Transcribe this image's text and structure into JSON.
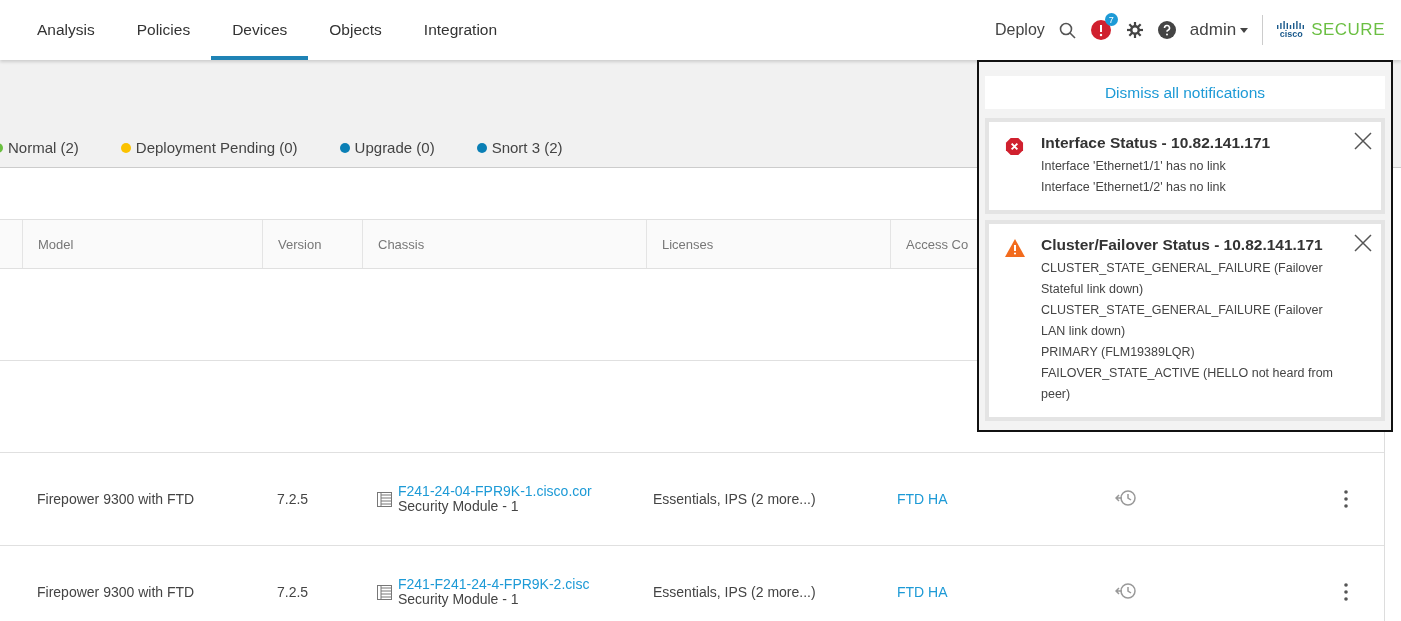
{
  "nav": {
    "tabs": [
      {
        "label": "Analysis",
        "selected": false
      },
      {
        "label": "Policies",
        "selected": false
      },
      {
        "label": "Devices",
        "selected": true
      },
      {
        "label": "Objects",
        "selected": false
      },
      {
        "label": "Integration",
        "selected": false
      }
    ],
    "deploy": "Deploy",
    "notification_count": "7",
    "user": "admin",
    "logo": {
      "wordmark": "cisco",
      "product": "SECURE"
    }
  },
  "status_legend": [
    {
      "label": "Normal (2)",
      "color": "#6abf3f"
    },
    {
      "label": "Deployment Pending (0)",
      "color": "#fbc200"
    },
    {
      "label": "Upgrade (0)",
      "color": "#0a7fb5"
    },
    {
      "label": "Snort 3 (2)",
      "color": "#0a7fb5"
    }
  ],
  "table": {
    "columns": [
      "Model",
      "Version",
      "Chassis",
      "Licenses",
      "Access Co"
    ],
    "rows": [
      {
        "model": "Firepower 9300 with FTD",
        "version": "7.2.5",
        "chassis": "F241-24-04-FPR9K-1.cisco.cor",
        "module": "Security Module - 1",
        "licenses": "Essentials, IPS (2 more...)",
        "access_policy": "FTD HA"
      },
      {
        "model": "Firepower 9300 with FTD",
        "version": "7.2.5",
        "chassis": "F241-F241-24-4-FPR9K-2.cisc",
        "module": "Security Module - 1",
        "licenses": "Essentials, IPS (2 more...)",
        "access_policy": "FTD HA"
      }
    ]
  },
  "notifications": {
    "dismiss_all": "Dismiss all notifications",
    "items": [
      {
        "kind": "error",
        "title": "Interface Status - 10.82.141.171",
        "lines": [
          "Interface 'Ethernet1/1' has no link",
          "Interface 'Ethernet1/2' has no link"
        ]
      },
      {
        "kind": "warning",
        "title": "Cluster/Failover Status - 10.82.141.171",
        "lines": [
          "CLUSTER_STATE_GENERAL_FAILURE (Failover Stateful link down)",
          "CLUSTER_STATE_GENERAL_FAILURE (Failover LAN link down)",
          "PRIMARY (FLM19389LQR)",
          "FAILOVER_STATE_ACTIVE (HELLO not heard from peer)"
        ]
      }
    ]
  }
}
